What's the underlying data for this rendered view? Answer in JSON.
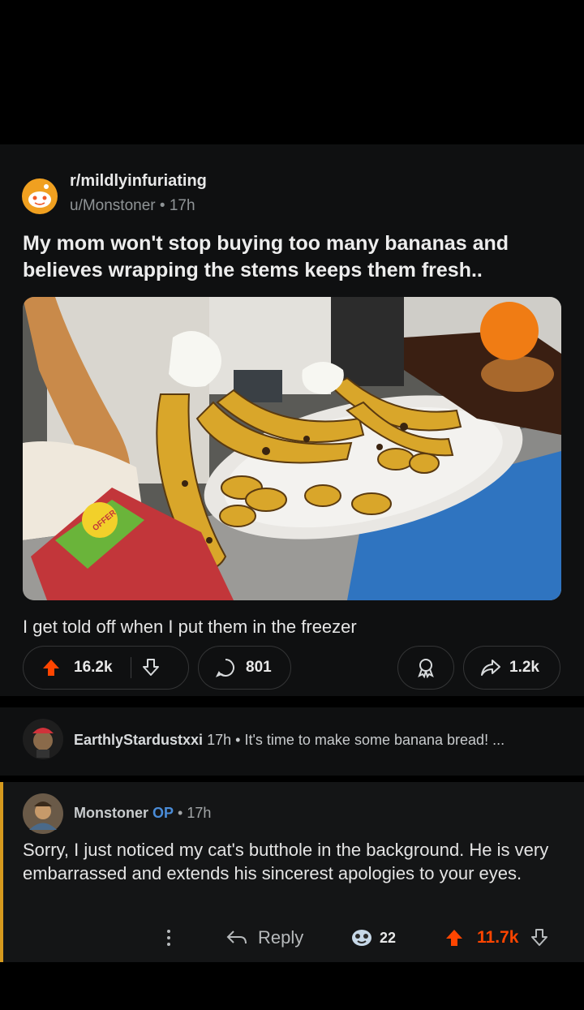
{
  "post": {
    "subreddit": "r/mildlyinfuriating",
    "author": "u/Monstoner",
    "age": "17h",
    "title": "My mom won't stop buying too many bananas and believes wrapping the stems keeps them fresh..",
    "body": "I get told off when I put them in the freezer",
    "upvotes": "16.2k",
    "comments": "801",
    "shares": "1.2k",
    "image_label": "OFFER"
  },
  "comments": [
    {
      "author": "EarthlyStardustxxi",
      "age": "17h",
      "text": "It's time to make some banana bread! ..."
    },
    {
      "author": "Monstoner",
      "badge": "OP",
      "age": "17h",
      "text": "Sorry, I just noticed my cat's butthole in the background. He is very embarrassed and extends his sincerest apologies to your eyes.",
      "reply_label": "Reply",
      "awards": "22",
      "upvotes": "11.7k"
    }
  ],
  "colors": {
    "upvote": "#ff4500",
    "op_badge": "#4a8cd8",
    "op_border": "#d69a1e"
  }
}
